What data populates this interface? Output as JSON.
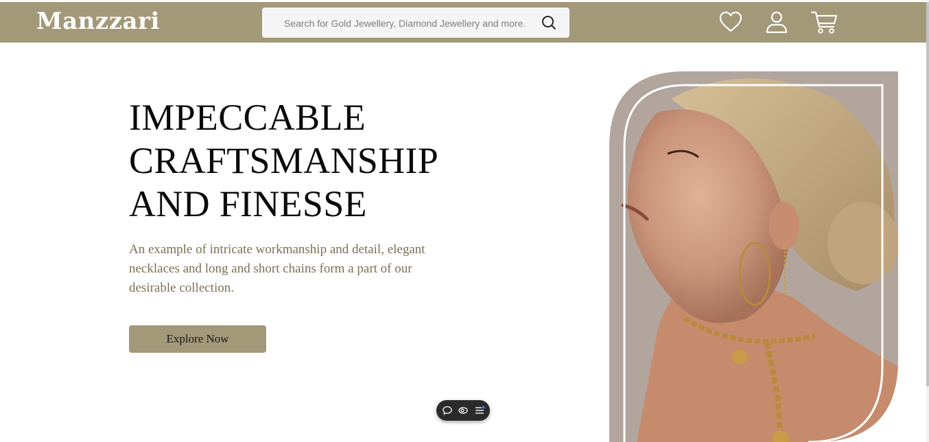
{
  "brand": {
    "name": "Manzzari"
  },
  "search": {
    "placeholder": "Search for Gold Jewellery, Diamond Jewellery and more...",
    "icon": "search-icon"
  },
  "header_icons": [
    "heart-icon",
    "user-icon",
    "cart-icon"
  ],
  "hero": {
    "title_lines": [
      "IMPECCABLE",
      "CRAFTSMANSHIP",
      "AND FINESSE"
    ],
    "description": "An example of intricate workmanship and detail, elegant necklaces and long and short chains form a part of our desirable collection.",
    "cta_label": "Explore Now"
  },
  "floating_toolbar": {
    "icons": [
      "chat-icon",
      "eye-icon",
      "list-icon"
    ]
  },
  "colors": {
    "header_bg": "#a39878",
    "cta_bg": "#a39878",
    "description_text": "#7a7055",
    "title_text": "#0a0a0a"
  }
}
